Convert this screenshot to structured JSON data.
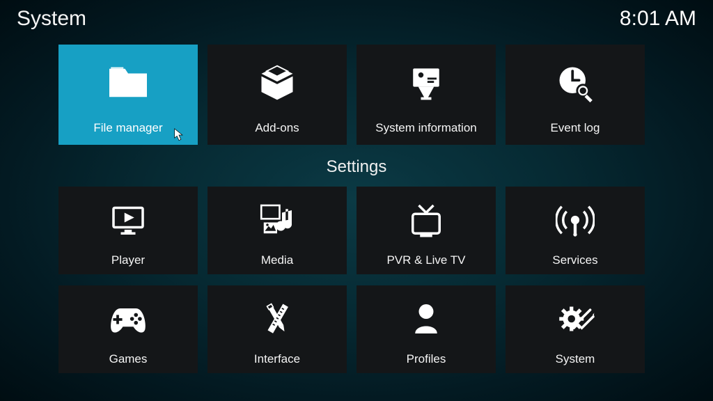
{
  "header": {
    "title": "System",
    "clock": "8:01 AM"
  },
  "sections": {
    "settings_label": "Settings"
  },
  "tiles": {
    "top": [
      {
        "id": "file-manager",
        "label": "File manager",
        "icon": "folder-icon",
        "selected": true
      },
      {
        "id": "add-ons",
        "label": "Add-ons",
        "icon": "box-icon",
        "selected": false
      },
      {
        "id": "system-information",
        "label": "System information",
        "icon": "projector-icon",
        "selected": false
      },
      {
        "id": "event-log",
        "label": "Event log",
        "icon": "clock-search-icon",
        "selected": false
      }
    ],
    "settings": [
      {
        "id": "player",
        "label": "Player",
        "icon": "monitor-play-icon"
      },
      {
        "id": "media",
        "label": "Media",
        "icon": "media-library-icon"
      },
      {
        "id": "pvr-live-tv",
        "label": "PVR & Live TV",
        "icon": "tv-icon"
      },
      {
        "id": "services",
        "label": "Services",
        "icon": "broadcast-icon"
      },
      {
        "id": "games",
        "label": "Games",
        "icon": "gamepad-icon"
      },
      {
        "id": "interface",
        "label": "Interface",
        "icon": "pencil-ruler-icon"
      },
      {
        "id": "profiles",
        "label": "Profiles",
        "icon": "person-icon"
      },
      {
        "id": "system",
        "label": "System",
        "icon": "gear-tools-icon"
      }
    ]
  }
}
